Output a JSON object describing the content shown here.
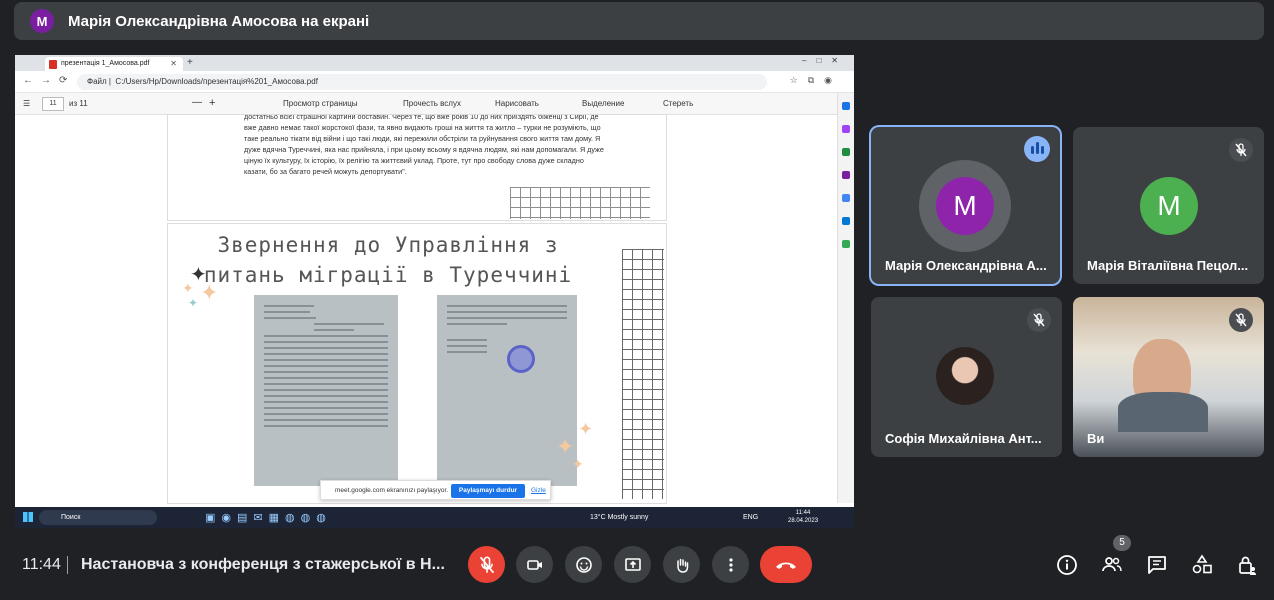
{
  "banner": {
    "avatar_letter": "M",
    "text": "Марія Олександрівна Амосова на екрані"
  },
  "browser": {
    "tab_title": "презентація 1_Амосова.pdf",
    "url_label": "Файл",
    "url": "C:/Users/Hp/Downloads/презентація%201_Амосова.pdf",
    "page_current": "11",
    "page_total": "из 11",
    "toolbar": {
      "zoom_minus": "—",
      "zoom_plus": "+",
      "view": "Просмотр страницы",
      "read": "Прочесть вслух",
      "draw": "Нарисовать",
      "highlight": "Выделение",
      "erase": "Стереть"
    }
  },
  "slide": {
    "page1_text": "достатньо всієї страшної картини обставин. Через те, що вже років 10 до них приїздять біженці з Сирії, де вже давно немає такої жорстокої фази, та явно видають гроші на життя та житло – турки не розуміють, що таке реально тікати від війни і що такі люди, які пережили обстріли та руйнування свого життя там дому. Я дуже вдячна Туреччині, яка нас прийняла, і при цьому всьому я вдячна людям, які нам допомагали. Я дуже ціную їх культуру, їх історію, їх релігію та життєвий уклад. Проте, тут про свободу слова дуже складно казати, бо за багато речей можуть депортувати\".",
    "title_line1": "Звернення до  Управління з",
    "title_line2": "питань міграції в Туреччині"
  },
  "share_notice": {
    "text": "meet.google.com ekranınızı paylaşıyor.",
    "stop": "Paylaşmayı durdur",
    "hide": "Gizle"
  },
  "taskbar": {
    "search": "Поиск",
    "weather": "13°C  Mostly sunny",
    "lang": "ENG",
    "time": "11:44",
    "date": "28.04.2023"
  },
  "participants": [
    {
      "name": "Марія Олександрівна А...",
      "letter": "M",
      "color": "#8e24aa",
      "state": "speaking"
    },
    {
      "name": "Марія Віталіївна Пецол...",
      "letter": "M",
      "color": "#4caf50",
      "state": "muted"
    },
    {
      "name": "Софія Михайлівна Ант...",
      "state": "muted"
    },
    {
      "name": "Ви",
      "state": "muted"
    }
  ],
  "bottom": {
    "time": "11:44",
    "meeting_title": "Настановча з конференця з стажерської в Н...",
    "people_count": "5"
  },
  "colors": {
    "accent": "#8ab4f8",
    "danger": "#ea4335",
    "bg": "#202124",
    "tile": "#3c4043"
  }
}
